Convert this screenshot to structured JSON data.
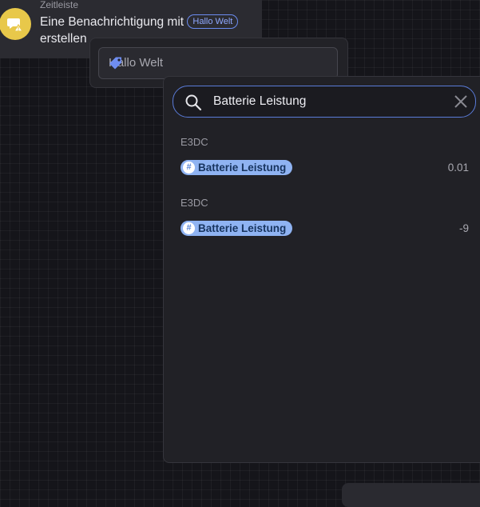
{
  "node": {
    "category": "Zeitleiste",
    "title": "Eine Benachrichtigung mit",
    "title_tail": "erstellen",
    "chip": "Hallo Welt"
  },
  "text_field": {
    "value": "Hallo Welt"
  },
  "search": {
    "query": "Batterie Leistung",
    "results": [
      {
        "group": "E3DC",
        "label": "Batterie Leistung",
        "value": "0.01"
      },
      {
        "group": "E3DC",
        "label": "Batterie Leistung",
        "value": "-9"
      }
    ]
  },
  "icons": {
    "node": "message-alert-icon",
    "tag": "tag-icon",
    "search": "search-icon",
    "clear": "close-icon",
    "hash": "hash-icon"
  },
  "colors": {
    "node_icon": "#e8c84a",
    "accent": "#5a7bd8",
    "chip_bg": "#8fb3f2"
  }
}
